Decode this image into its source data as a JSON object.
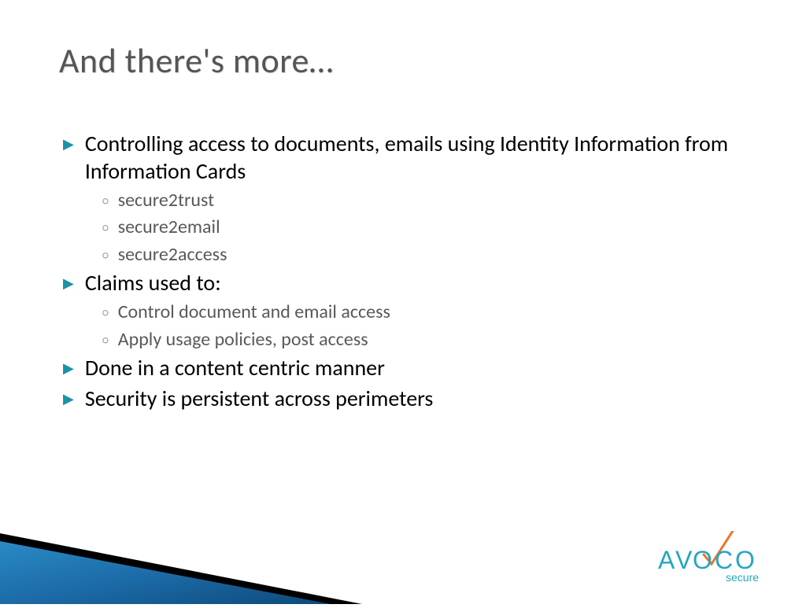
{
  "title": "And there's more…",
  "bullets": [
    {
      "text": "Controlling access to documents, emails using Identity Information from Information Cards",
      "subs": [
        "secure2trust",
        "secure2email",
        "secure2access"
      ]
    },
    {
      "text": "Claims used to:",
      "subs": [
        "Control document and email access",
        "Apply usage policies, post access"
      ]
    },
    {
      "text": "Done in a content centric manner",
      "subs": []
    },
    {
      "text": "Security is persistent across perimeters",
      "subs": []
    }
  ],
  "logo": {
    "brand_main": "AVOCO",
    "brand_sub": "secure"
  }
}
